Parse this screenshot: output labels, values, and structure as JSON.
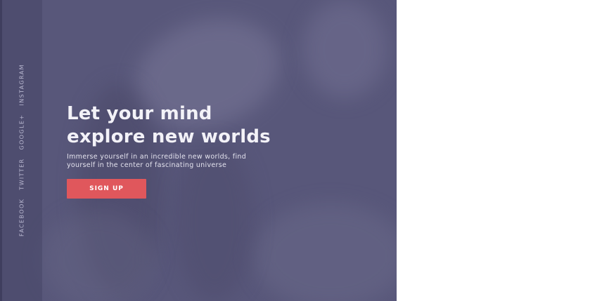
{
  "hero": {
    "headline_line1": "Let your mind",
    "headline_line2": "explore new worlds",
    "subtext_line1": "Immerse yourself in an incredible new worlds, find",
    "subtext_line2": "yourself in the center of fascinating universe",
    "cta_label": "SIGN UP",
    "background_color": "#58577a",
    "cta_color": "#e0575c"
  },
  "social": {
    "links": [
      "FACEBOOK",
      "TWITTER",
      "GOOGLE+",
      "INSTAGRAM"
    ]
  }
}
